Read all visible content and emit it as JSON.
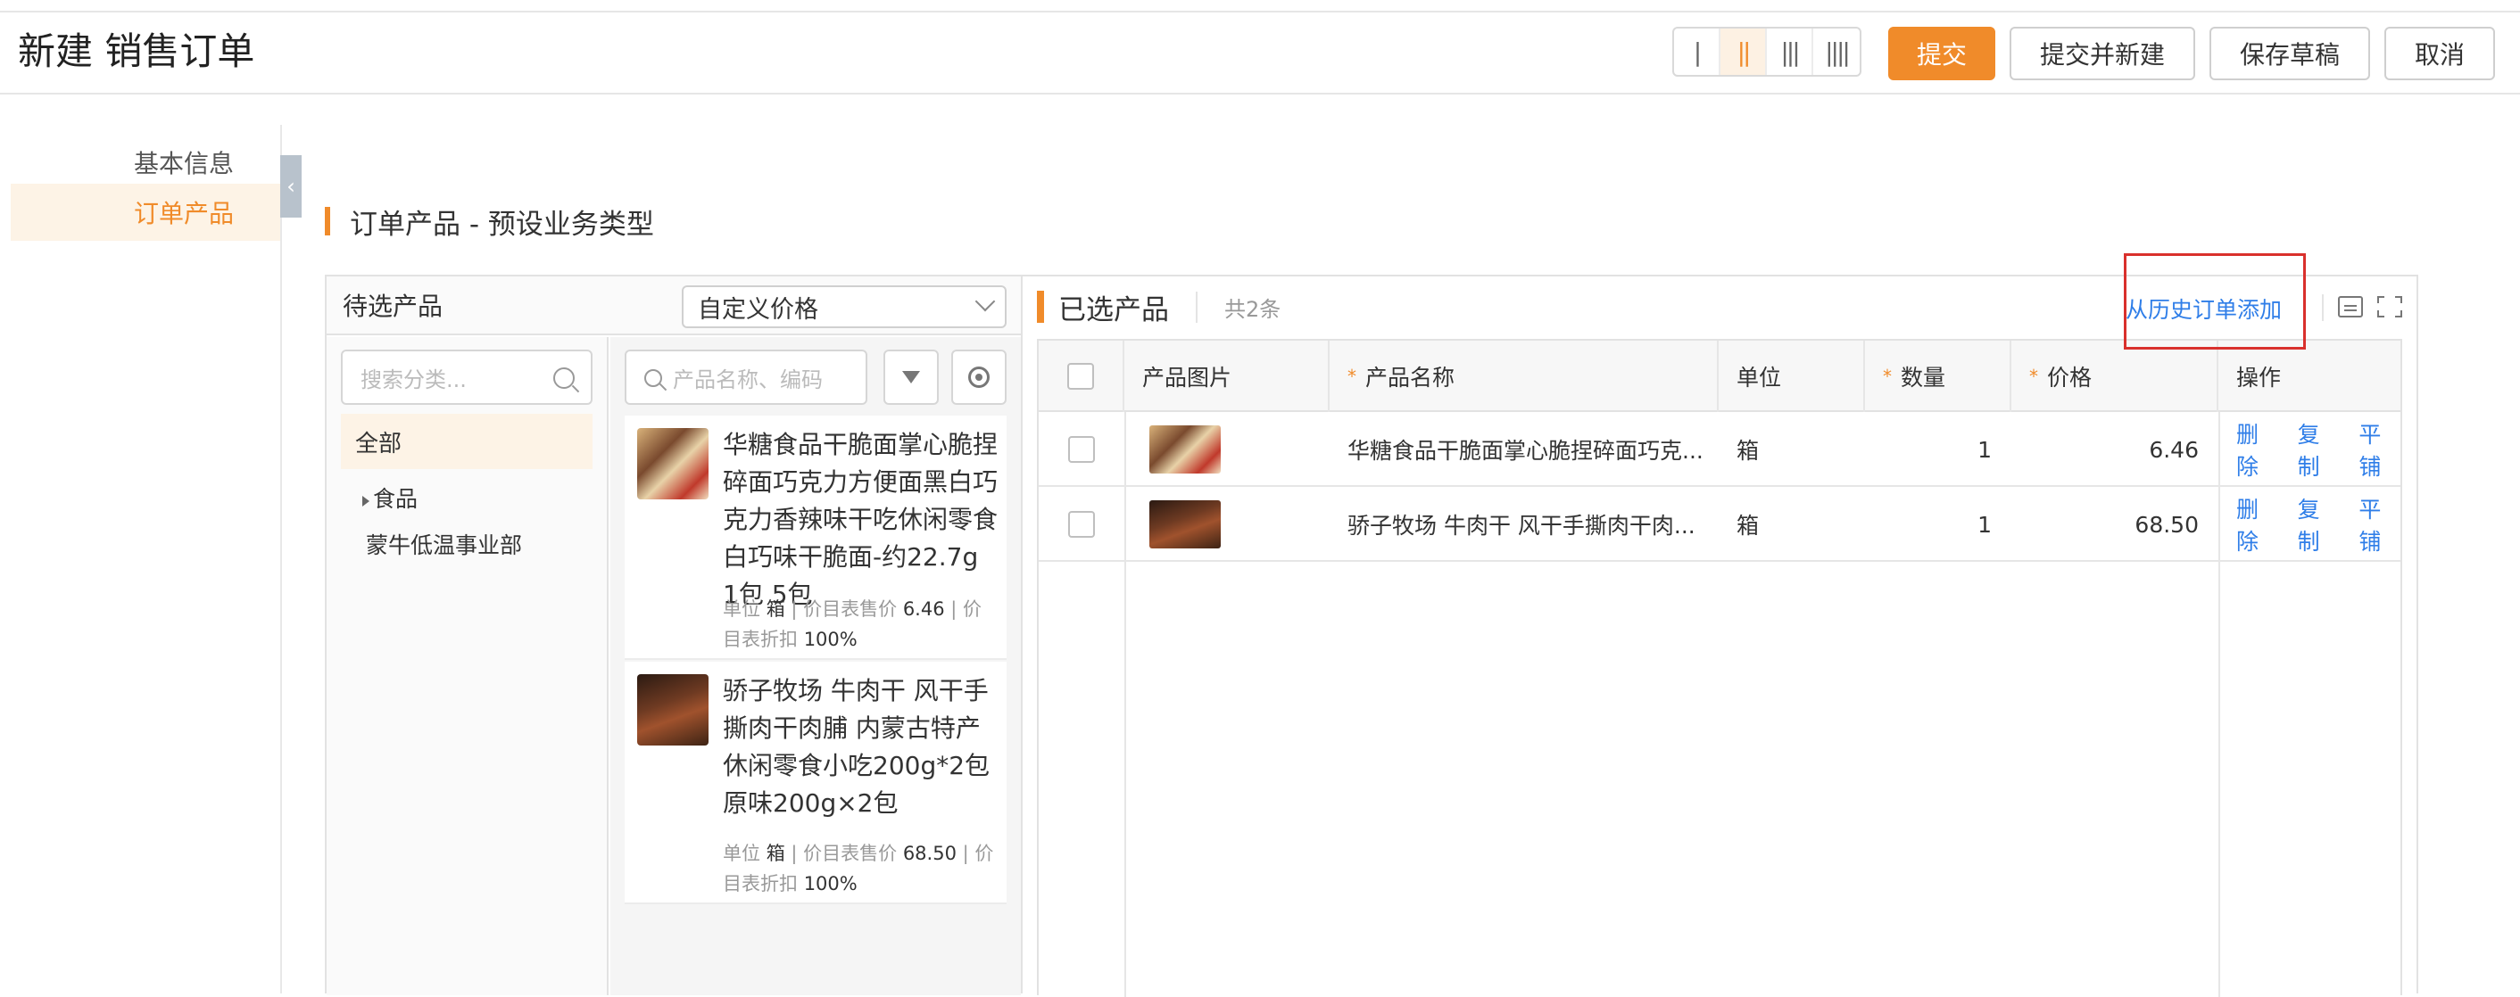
{
  "header": {
    "title": "新建 销售订单",
    "column_layouts": [
      "|",
      "||",
      "|||",
      "||||"
    ],
    "active_layout_index": 1,
    "buttons": {
      "submit": "提交",
      "submit_and_new": "提交并新建",
      "save_draft": "保存草稿",
      "cancel": "取消"
    }
  },
  "sidebar": {
    "items": [
      {
        "label": "基本信息",
        "active": false
      },
      {
        "label": "订单产品",
        "active": true
      }
    ]
  },
  "section": {
    "title": "订单产品 - 预设业务类型"
  },
  "left_panel": {
    "title": "待选产品",
    "price_select": "自定义价格",
    "category_search_placeholder": "搜索分类...",
    "categories": {
      "all": "全部",
      "food": "食品",
      "dept": "蒙牛低温事业部"
    },
    "product_search_placeholder": "产品名称、编码",
    "products": [
      {
        "name": "华糖食品干脆面掌心脆捏碎面巧克力方便面黑白巧克力香辣味干吃休闲零食 白巧味干脆面-约22.7g 1包 5包",
        "unit_label": "单位",
        "unit": "箱",
        "price_label": "价目表售价",
        "price": "6.46",
        "discount_label": "价目表折扣",
        "discount": "100%"
      },
      {
        "name": "骄子牧场 牛肉干 风干手撕肉干肉脯 内蒙古特产休闲零食小吃200g*2包 原味200g×2包",
        "unit_label": "单位",
        "unit": "箱",
        "price_label": "价目表售价",
        "price": "68.50",
        "discount_label": "价目表折扣",
        "discount": "100%"
      }
    ]
  },
  "right_panel": {
    "title": "已选产品",
    "count": "共2条",
    "history_add": "从历史订单添加",
    "columns": {
      "image": "产品图片",
      "name": "产品名称",
      "unit": "单位",
      "qty": "数量",
      "price": "价格",
      "actions": "操作"
    },
    "rows": [
      {
        "name": "华糖食品干脆面掌心脆捏碎面巧克...",
        "unit": "箱",
        "qty": "1",
        "price": "6.46"
      },
      {
        "name": "骄子牧场 牛肉干 风干手撕肉干肉...",
        "unit": "箱",
        "qty": "1",
        "price": "68.50"
      }
    ],
    "actions": {
      "delete": "删除",
      "copy": "复制",
      "tile": "平铺"
    }
  }
}
